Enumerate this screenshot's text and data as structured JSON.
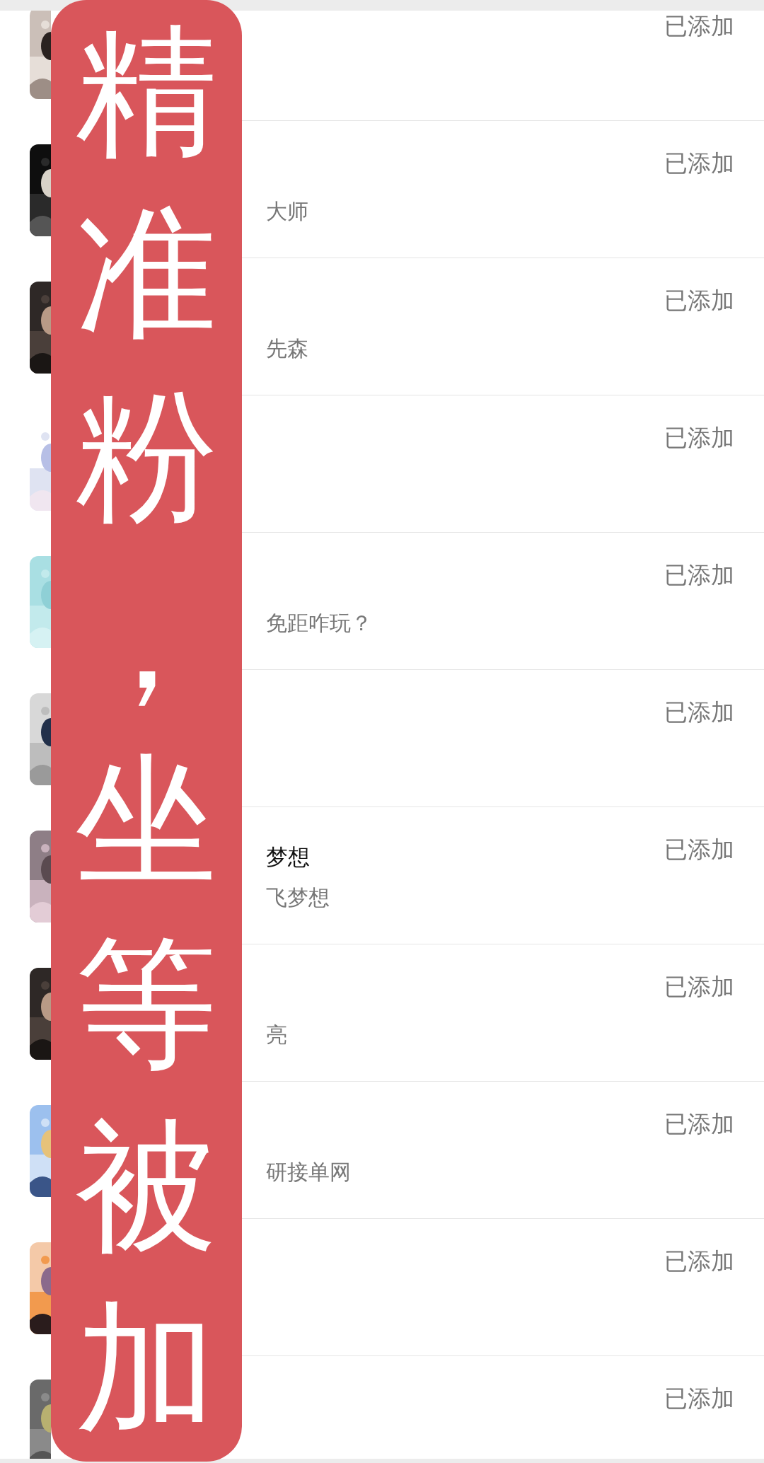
{
  "banner": {
    "text": "精准粉，坐等被加"
  },
  "contacts": [
    {
      "status": "已添加"
    },
    {
      "subtitle": "大师",
      "status": "已添加"
    },
    {
      "subtitle": "先森",
      "status": "已添加"
    },
    {
      "status": "已添加"
    },
    {
      "subtitle": "免距咋玩？",
      "status": "已添加"
    },
    {
      "status": "已添加"
    },
    {
      "name": "梦想",
      "subtitle": "飞梦想",
      "status": "已添加"
    },
    {
      "subtitle": "亮",
      "status": "已添加"
    },
    {
      "subtitle": "研接单网",
      "status": "已添加"
    },
    {
      "status": "已添加"
    },
    {
      "status": "已添加"
    }
  ]
}
